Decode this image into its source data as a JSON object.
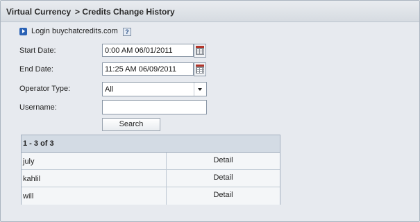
{
  "breadcrumb": {
    "root": "Virtual Currency",
    "current": "> Credits Change History"
  },
  "login": {
    "text": "Login buychatcredits.com",
    "help": "?"
  },
  "form": {
    "start_label": "Start Date:",
    "start_value": "0:00 AM 06/01/2011",
    "end_label": "End Date:",
    "end_value": "11:25 AM 06/09/2011",
    "operator_label": "Operator Type:",
    "operator_value": "All",
    "username_label": "Username:",
    "username_value": "",
    "search_label": "Search"
  },
  "results": {
    "count": "1 - 3 of 3",
    "rows": [
      {
        "name": "july",
        "action": "Detail"
      },
      {
        "name": "kahlil",
        "action": "Detail"
      },
      {
        "name": "will",
        "action": "Detail"
      }
    ]
  }
}
